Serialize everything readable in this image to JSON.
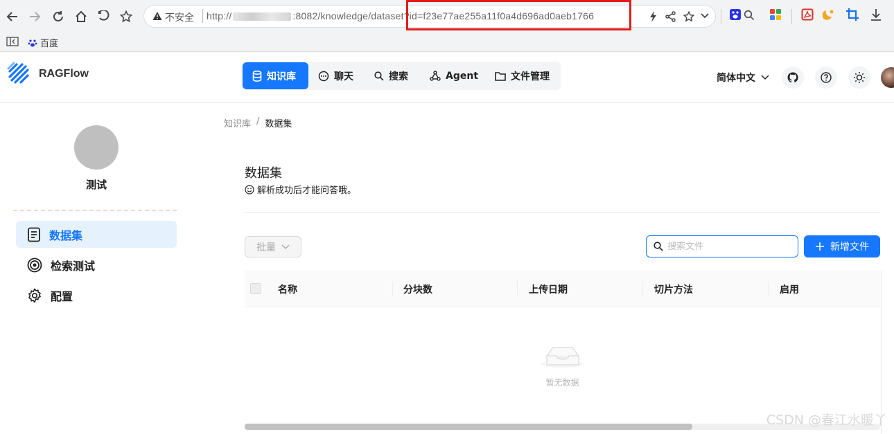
{
  "browser": {
    "address": {
      "security_label": "不安全",
      "url_prefix": "http://",
      "url_rest": ":8082/knowledge/dataset?id=f23e77ae255a11f0a4d696ad0aeb1766"
    },
    "bookmarks": [
      {
        "label": "百度",
        "icon": "baidu-paw-icon"
      }
    ]
  },
  "app": {
    "logo_text": "RAGFlow",
    "nav": [
      {
        "label": "知识库",
        "icon": "database-icon",
        "active": true
      },
      {
        "label": "聊天",
        "icon": "chat-bubble-icon"
      },
      {
        "label": "搜索",
        "icon": "search-icon"
      },
      {
        "label": "Agent",
        "icon": "agent-graph-icon"
      },
      {
        "label": "文件管理",
        "icon": "folder-icon"
      }
    ],
    "language": "简体中文",
    "accent": "#1677ff"
  },
  "sidebar": {
    "kb_name": "测试",
    "items": [
      {
        "label": "数据集",
        "icon": "document-icon",
        "active": true
      },
      {
        "label": "检索测试",
        "icon": "target-icon"
      },
      {
        "label": "配置",
        "icon": "gear-icon"
      }
    ]
  },
  "main": {
    "breadcrumb": [
      "知识库",
      "数据集"
    ],
    "title": "数据集",
    "description": "解析成功后才能问答哦。",
    "batch_label": "批量",
    "search_placeholder": "搜索文件",
    "add_label": "新增文件",
    "table": {
      "columns": [
        "名称",
        "分块数",
        "上传日期",
        "切片方法",
        "启用"
      ],
      "rows": [],
      "empty_text": "暂无数据"
    }
  },
  "watermark": "CSDN @春江水暖丫"
}
